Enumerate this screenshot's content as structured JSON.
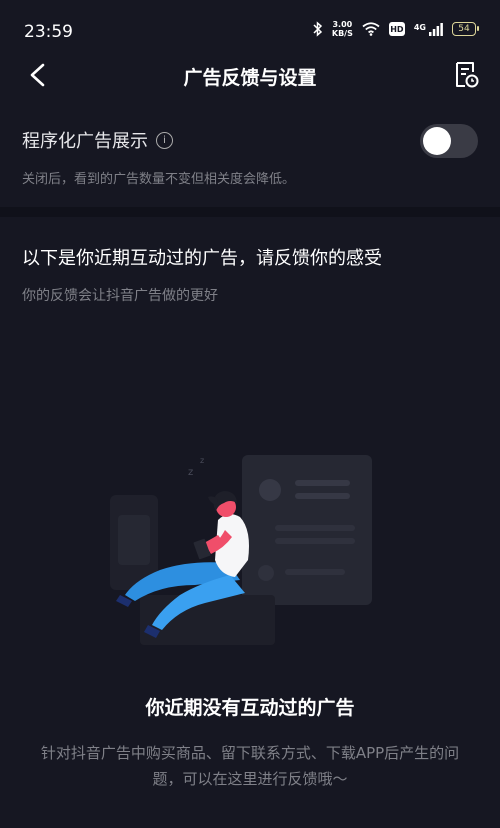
{
  "status": {
    "time": "23:59",
    "speed_value": "3.00",
    "speed_unit": "KB/S",
    "hd": "HD",
    "network": "4G",
    "battery": "54"
  },
  "nav": {
    "title": "广告反馈与设置"
  },
  "setting": {
    "label": "程序化广告展示",
    "description": "关闭后，看到的广告数量不变但相关度会降低。",
    "toggle_on": false
  },
  "feedback": {
    "title": "以下是你近期互动过的广告，请反馈你的感受",
    "subtitle": "你的反馈会让抖音广告做的更好"
  },
  "empty": {
    "title": "你近期没有互动过的广告",
    "description": "针对抖音广告中购买商品、留下联系方式、下载APP后产生的问题，可以在这里进行反馈哦～"
  },
  "colors": {
    "background": "#161722",
    "toggle_off": "#3a3b45",
    "figure_skin": "#f04e6a",
    "figure_pants": "#2d8fe0"
  }
}
